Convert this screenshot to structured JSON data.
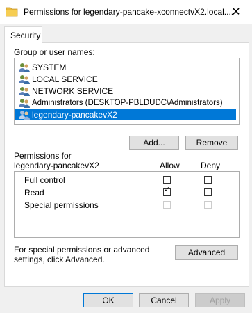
{
  "window": {
    "title": "Permissions for legendary-pancake-xconnectvX2.local....",
    "close_glyph": "✕"
  },
  "tabs": [
    {
      "label": "Security"
    }
  ],
  "group_section": {
    "label": "Group or user names:",
    "users": [
      {
        "name": "SYSTEM"
      },
      {
        "name": "LOCAL SERVICE"
      },
      {
        "name": "NETWORK SERVICE"
      },
      {
        "name": "Administrators (DESKTOP-PBLDUDC\\Administrators)"
      },
      {
        "name": "legendary-pancakevX2",
        "selected": true
      }
    ],
    "add_label": "Add...",
    "remove_label": "Remove"
  },
  "permissions": {
    "title_line1": "Permissions for",
    "title_line2": "legendary-pancakevX2",
    "allow_header": "Allow",
    "deny_header": "Deny",
    "rows": [
      {
        "label": "Full control",
        "allow": false,
        "deny": false,
        "enabled": true
      },
      {
        "label": "Read",
        "allow": true,
        "deny": false,
        "enabled": true
      },
      {
        "label": "Special permissions",
        "allow": false,
        "deny": false,
        "enabled": false
      }
    ]
  },
  "advanced": {
    "hint": "For special permissions or advanced settings, click Advanced.",
    "button_label": "Advanced"
  },
  "footer": {
    "ok_label": "OK",
    "cancel_label": "Cancel",
    "apply_label": "Apply"
  },
  "colors": {
    "selection": "#0078d7",
    "window_bg": "#f0f0f0",
    "folder": "#e8b83a"
  },
  "icons": {
    "window_icon": "folder-icon",
    "user_icon": "users-group-icon",
    "check_glyph": "✓"
  }
}
